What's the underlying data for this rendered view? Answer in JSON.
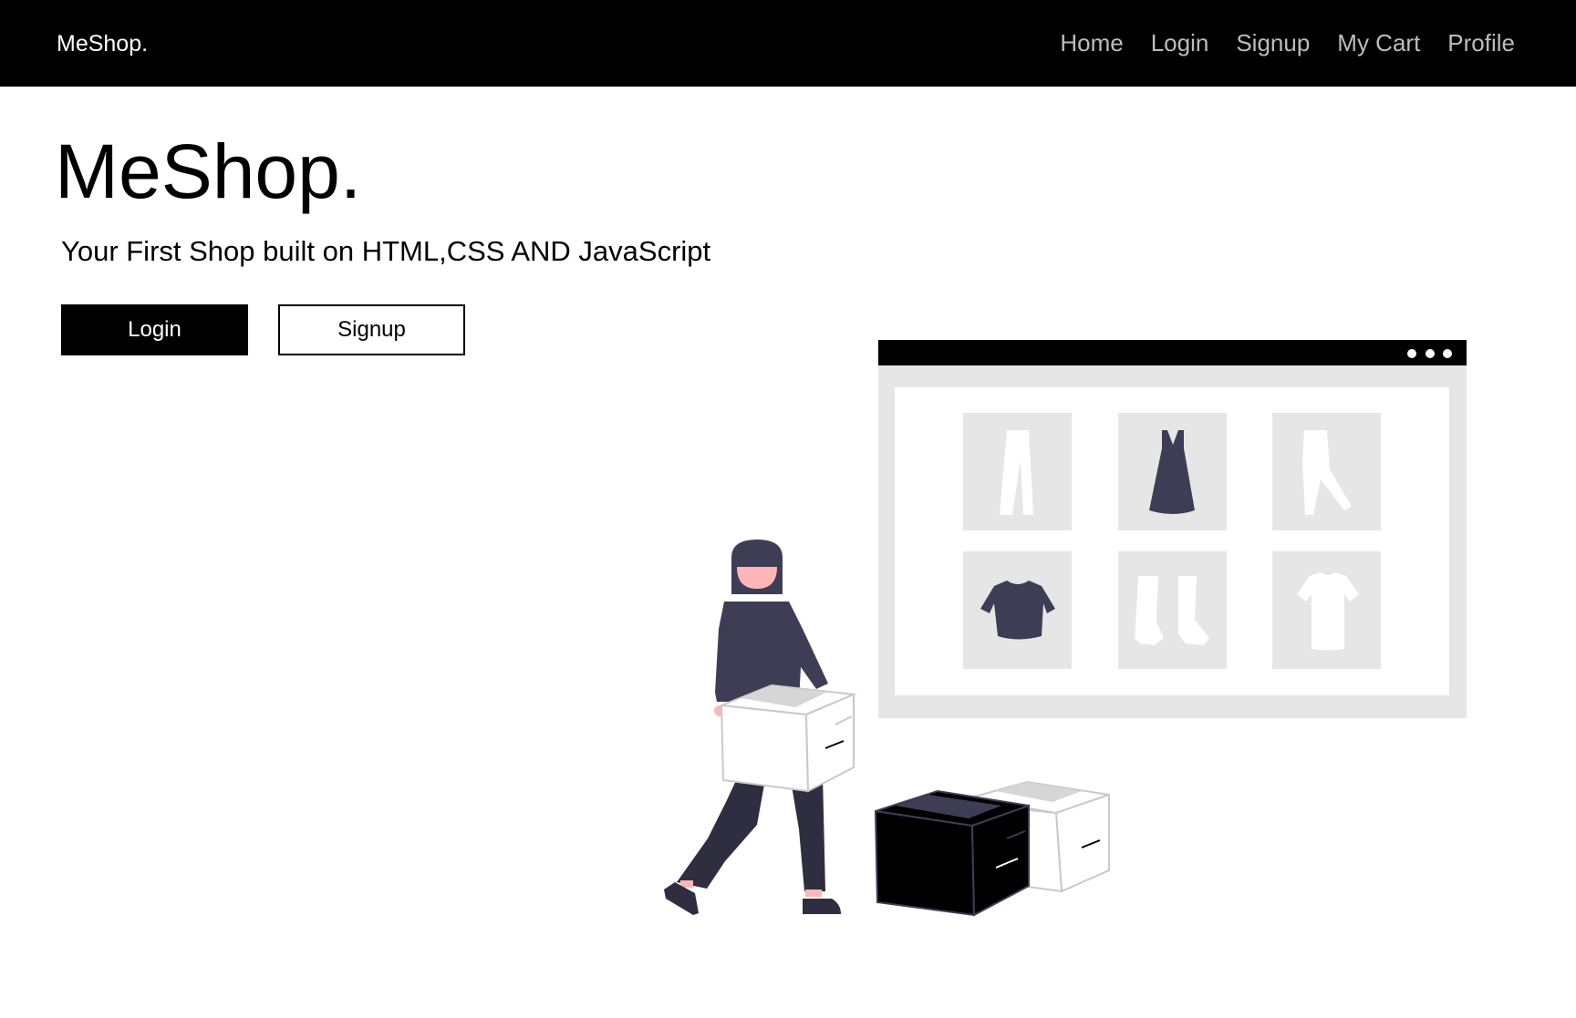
{
  "navbar": {
    "brand": "MeShop.",
    "links": [
      "Home",
      "Login",
      "Signup",
      "My Cart",
      "Profile"
    ]
  },
  "hero": {
    "title": "MeShop.",
    "subtitle": "Your First Shop built on HTML,CSS AND JavaScript",
    "login_label": "Login",
    "signup_label": "Signup"
  },
  "illustration": {
    "icons": [
      "pants-icon",
      "dress-icon",
      "trousers-icon",
      "crop-top-icon",
      "boots-icon",
      "tshirt-icon"
    ]
  },
  "colors": {
    "nav_bg": "#000000",
    "nav_link": "#bdbdbd",
    "figure_dark": "#3f3d56",
    "skin": "#ffb6b6",
    "panel_gray": "#e6e6e6"
  }
}
